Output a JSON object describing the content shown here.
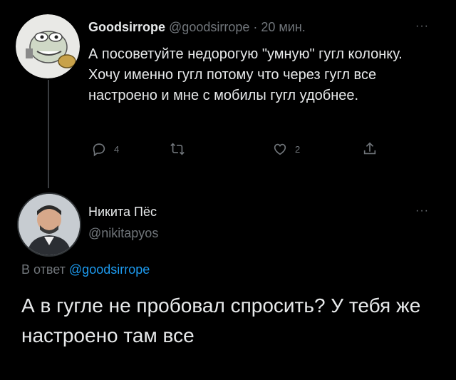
{
  "tweet1": {
    "author_name": "Goodsirrope",
    "handle": "@goodsirrope",
    "separator": "·",
    "time": "20 мин.",
    "more": "···",
    "text": "А посоветуйте недорогую \"умную\" гугл колонку. Хочу именно гугл потому что через гугл все настроено и мне с мобилы гугл удобнее.",
    "actions": {
      "reply_count": "4",
      "retweet_count": "",
      "like_count": "2",
      "share_count": ""
    },
    "icons": [
      "reply-icon",
      "retweet-icon",
      "like-icon",
      "share-icon"
    ]
  },
  "tweet2": {
    "author_name": "Никита Пёс",
    "handle": "@nikitapyos",
    "more": "···",
    "reply_prefix": "В ответ",
    "reply_to": "@goodsirrope",
    "text": "А в гугле не пробовал спросить? У тебя же настроено там все"
  },
  "colors": {
    "background": "#000000",
    "text": "#e7e9ea",
    "muted": "#71767b",
    "link": "#1d9bf0"
  }
}
